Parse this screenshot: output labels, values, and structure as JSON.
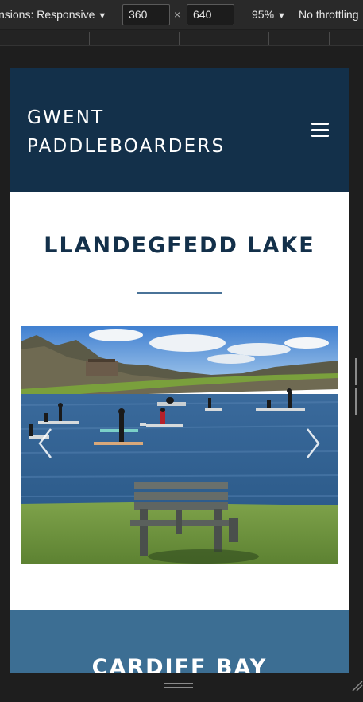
{
  "devtools": {
    "dimensions_label": "nsions: Responsive",
    "width_value": "360",
    "height_value": "640",
    "times_symbol": "×",
    "zoom_label": "95%",
    "throttle_label": "No throttling",
    "caret": "▼"
  },
  "site": {
    "brand_line1": "GWENT",
    "brand_line2": "PADDLEBOARDERS",
    "section_title": "LLANDEGFEDD LAKE",
    "next_section_title": "CARDIFF BAY",
    "colors": {
      "header_bg": "#13304a",
      "title_text": "#13304a",
      "rule": "#4a7398",
      "next_section_bg": "#3c6e93"
    }
  },
  "icons": {
    "menu": "hamburger-menu-icon",
    "prev": "chevron-left-icon",
    "next": "chevron-right-icon",
    "resize": "resize-grip-icon"
  }
}
